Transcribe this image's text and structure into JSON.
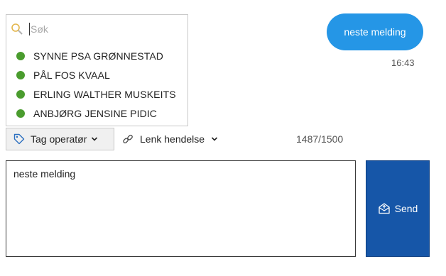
{
  "search": {
    "placeholder": "Søk",
    "value": ""
  },
  "operators": [
    {
      "name": "SYNNE PSA GRØNNESTAD",
      "status_color": "#4a9c2e"
    },
    {
      "name": "PÅL FOS KVAAL",
      "status_color": "#4a9c2e"
    },
    {
      "name": "ERLING WALTHER MUSKEITS",
      "status_color": "#4a9c2e"
    },
    {
      "name": "ANBJØRG JENSINE PIDIC",
      "status_color": "#4a9c2e"
    }
  ],
  "toolbar": {
    "tag_label": "Tag operatør",
    "link_label": "Lenk hendelse",
    "char_counter": "1487/1500"
  },
  "composer": {
    "message_value": "neste melding",
    "send_label": "Send"
  },
  "chat": {
    "last_message": "neste melding",
    "last_time": "16:43"
  },
  "colors": {
    "send_button": "#1656a8",
    "bubble": "#2596e6",
    "status_online": "#4a9c2e"
  }
}
